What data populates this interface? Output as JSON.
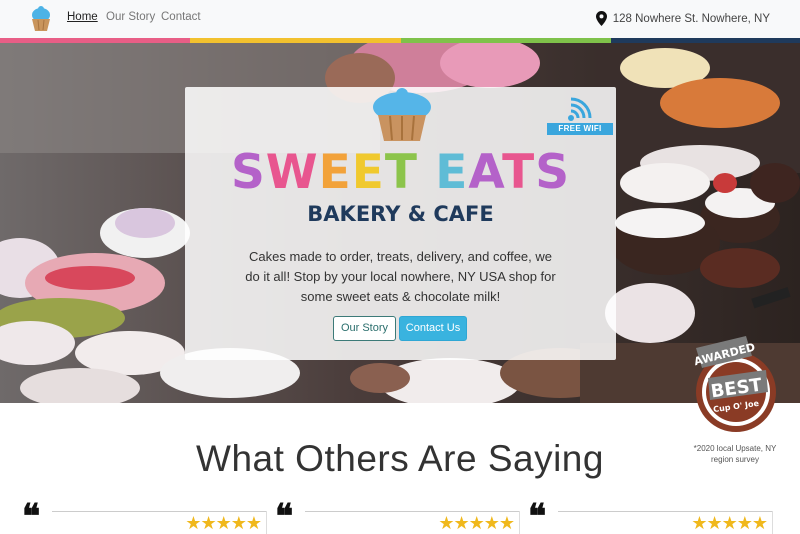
{
  "navbar": {
    "brand_icon": "cupcake-icon",
    "links": [
      {
        "label": "Home",
        "active": true
      },
      {
        "label": "Our Story",
        "active": false
      },
      {
        "label": "Contact",
        "active": false
      }
    ],
    "address_icon": "map-pin-icon",
    "address": "128 Nowhere St. Nowhere, NY"
  },
  "stripe_colors": [
    "#e85e86",
    "#f2c12e",
    "#7fc24a",
    "#1f3a5c"
  ],
  "hero": {
    "wifi_label": "FREE WIFI",
    "logo_title_letters": [
      {
        "ch": "S",
        "color": "#b462c9"
      },
      {
        "ch": "W",
        "color": "#e8568f"
      },
      {
        "ch": "E",
        "color": "#f2a23a"
      },
      {
        "ch": "E",
        "color": "#f0c92e"
      },
      {
        "ch": "T",
        "color": "#8cc44b"
      },
      {
        "ch": " ",
        "color": "#ffffff"
      },
      {
        "ch": "E",
        "color": "#5fbcd6"
      },
      {
        "ch": "A",
        "color": "#b462c9"
      },
      {
        "ch": "T",
        "color": "#e8568f"
      },
      {
        "ch": "S",
        "color": "#b462c9"
      }
    ],
    "logo_subtitle": "BAKERY & CAFE",
    "description": "Cakes made to order, treats, delivery, and coffee, we do it all! Stop by your local nowhere, NY USA shop for some sweet eats & chocolate milk!",
    "buttons": {
      "our_story": "Our Story",
      "contact_us": "Contact Us"
    }
  },
  "award": {
    "top": "AWARDED",
    "main": "BEST",
    "sub": "Cup O' Joe",
    "note": "*2020 local Upsate, NY region survey"
  },
  "testimonials": {
    "title": "What Others Are Saying",
    "quote_mark": "❝",
    "items": [
      {
        "stars": "★★★★★",
        "rating": 5
      },
      {
        "stars": "★★★★★",
        "rating": 5
      },
      {
        "stars": "★★★★★",
        "rating": 5
      }
    ]
  }
}
